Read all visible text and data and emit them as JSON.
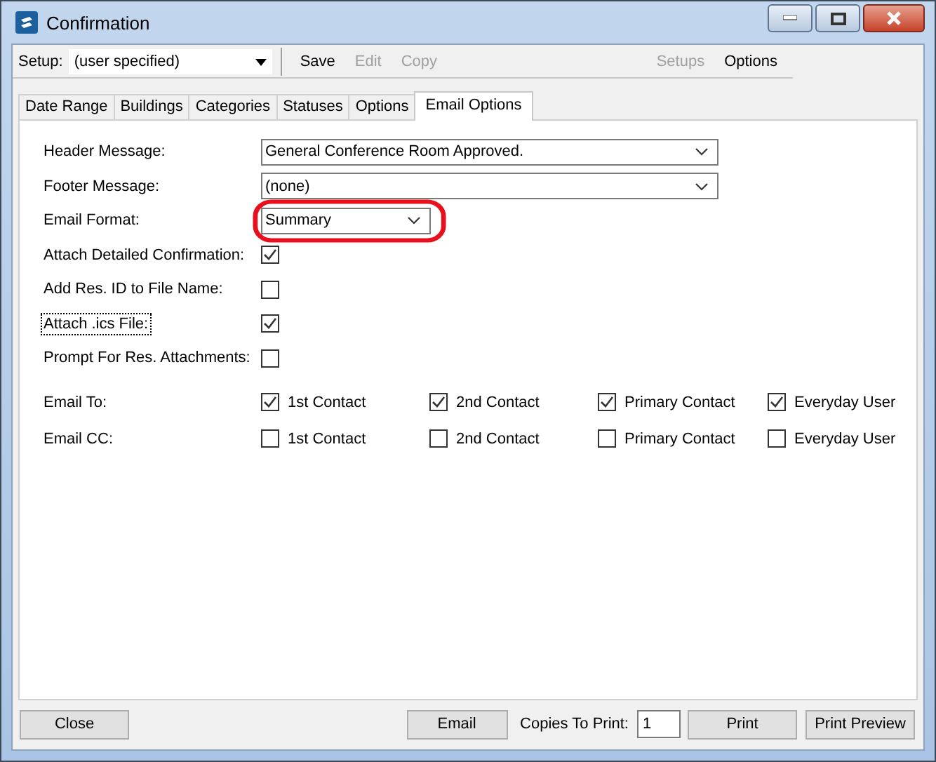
{
  "window": {
    "title": "Confirmation"
  },
  "toolbar": {
    "setup_label": "Setup:",
    "setup_value": "(user specified)",
    "actions": [
      {
        "label": "Save",
        "disabled": false
      },
      {
        "label": "Edit",
        "disabled": true
      },
      {
        "label": "Copy",
        "disabled": true
      }
    ],
    "right_actions": [
      {
        "label": "Setups",
        "disabled": true
      },
      {
        "label": "Options",
        "disabled": false
      }
    ]
  },
  "tabs": [
    {
      "label": "Date Range",
      "selected": false
    },
    {
      "label": "Buildings",
      "selected": false
    },
    {
      "label": "Categories",
      "selected": false
    },
    {
      "label": "Statuses",
      "selected": false
    },
    {
      "label": "Options",
      "selected": false
    },
    {
      "label": "Email Options",
      "selected": true
    }
  ],
  "fields": [
    {
      "kind": "dropdown",
      "label": "Header Message:",
      "value": "General Conference Room Approved.",
      "wide": true,
      "highlighted": false
    },
    {
      "kind": "dropdown",
      "label": "Footer Message:",
      "value": "(none)",
      "wide": true,
      "highlighted": false
    },
    {
      "kind": "dropdown",
      "label": "Email Format:",
      "value": "Summary",
      "wide": false,
      "highlighted": true
    },
    {
      "kind": "checkbox",
      "label": "Attach Detailed Confirmation:",
      "checked": true,
      "focused": false
    },
    {
      "kind": "checkbox",
      "label": "Add Res. ID to File Name:",
      "checked": false,
      "focused": false
    },
    {
      "kind": "checkbox",
      "label": "Attach .ics File:",
      "checked": true,
      "focused": true
    },
    {
      "kind": "checkbox",
      "label": "Prompt For Res. Attachments:",
      "checked": false,
      "focused": false
    }
  ],
  "recipients": [
    {
      "label": "Email To:",
      "options": [
        {
          "label": "1st Contact",
          "checked": true
        },
        {
          "label": "2nd Contact",
          "checked": true
        },
        {
          "label": "Primary Contact",
          "checked": true
        },
        {
          "label": "Everyday User",
          "checked": true
        }
      ]
    },
    {
      "label": "Email CC:",
      "options": [
        {
          "label": "1st Contact",
          "checked": false
        },
        {
          "label": "2nd Contact",
          "checked": false
        },
        {
          "label": "Primary Contact",
          "checked": false
        },
        {
          "label": "Everyday User",
          "checked": false
        }
      ]
    }
  ],
  "footer": {
    "close": "Close",
    "email": "Email",
    "copies_label": "Copies To Print:",
    "copies_value": "1",
    "print": "Print",
    "print_preview": "Print Preview"
  }
}
